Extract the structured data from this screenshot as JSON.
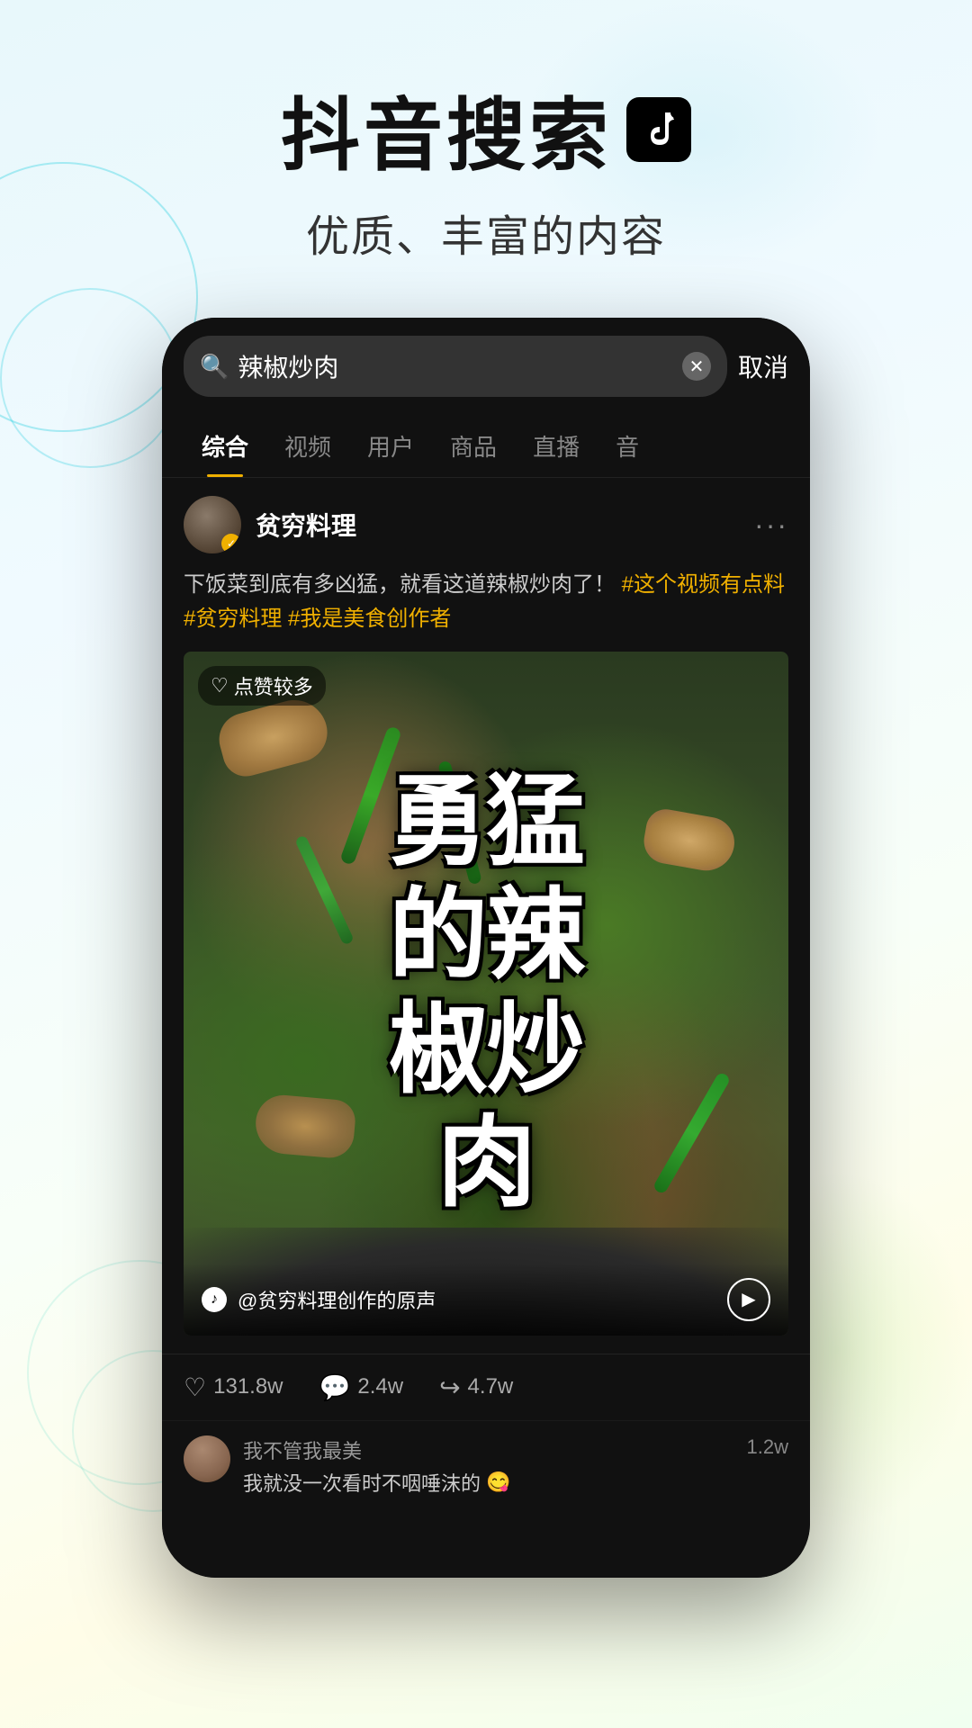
{
  "header": {
    "title": "抖音搜索",
    "subtitle": "优质、丰富的内容",
    "logo_label": "TikTok logo"
  },
  "search": {
    "query": "辣椒炒肉",
    "cancel_label": "取消"
  },
  "tabs": [
    {
      "label": "综合",
      "active": true
    },
    {
      "label": "视频",
      "active": false
    },
    {
      "label": "用户",
      "active": false
    },
    {
      "label": "商品",
      "active": false
    },
    {
      "label": "直播",
      "active": false
    },
    {
      "label": "音",
      "active": false
    }
  ],
  "post": {
    "username": "贫穷料理",
    "verified": true,
    "body_text": "下饭菜到底有多凶猛，就看这道辣椒炒肉了！",
    "hashtags": [
      "#这个视频有点料",
      "#贫穷料理",
      "#我是美食创作者"
    ],
    "like_badge": "点赞较多",
    "video_big_text": "勇猛的辣椒炒肉",
    "video_source": "@贫穷料理创作的原声",
    "engagement": {
      "likes": "131.8w",
      "comments": "2.4w",
      "shares": "4.7w"
    }
  },
  "comment_preview": {
    "username": "我不管我最美",
    "text": "我就没一次看时不咽唾沫的",
    "emoji": "😋",
    "count": "1.2w"
  }
}
